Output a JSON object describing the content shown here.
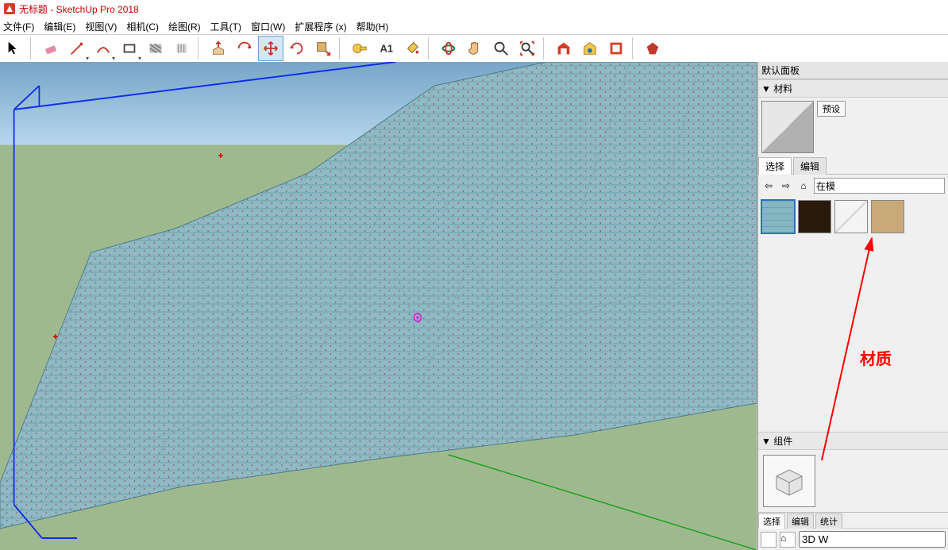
{
  "app": {
    "title": "无标题 - SketchUp Pro 2018"
  },
  "menu": {
    "file": "文件(F)",
    "edit": "编辑(E)",
    "view": "视图(V)",
    "camera": "相机(C)",
    "draw": "绘图(R)",
    "tools": "工具(T)",
    "window": "窗口(W)",
    "ext": "扩展程序 (x)",
    "help": "帮助(H)"
  },
  "toolbar_icons": [
    "select-arrow",
    "eraser",
    "pencil",
    "arc",
    "rectangle",
    "stripes",
    "rib",
    "pushpull",
    "offset",
    "move",
    "rotate",
    "scale",
    "tape",
    "protractor",
    "text-label",
    "paint-bucket",
    "orbit",
    "pan",
    "zoom",
    "zoom-extents",
    "warehouse",
    "warehouse2",
    "layout",
    "ruby"
  ],
  "sidepanel": {
    "title": "默认面板",
    "materials": {
      "header": "▼ 材料",
      "preset_btn": "预设",
      "tab_select": "选择",
      "tab_edit": "编辑",
      "dropdown_value": "在模",
      "swatches": [
        "blue-siding",
        "dark-wood",
        "white-diag",
        "tan"
      ]
    },
    "components": {
      "header": "▼ 组件",
      "tab_select": "选择",
      "tab_edit": "编辑",
      "tab_stats": "统计",
      "dropdown_value": "3D W"
    }
  },
  "annotation": {
    "label": "材质"
  }
}
